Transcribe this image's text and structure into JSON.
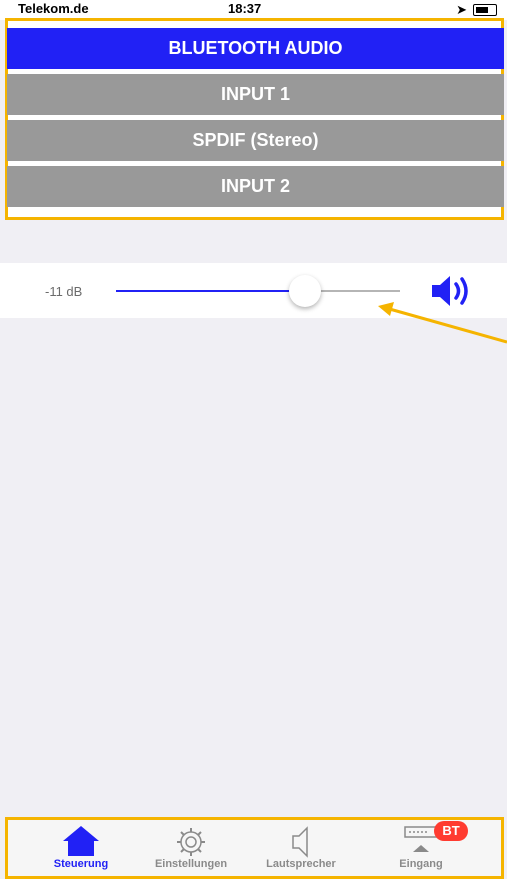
{
  "status_bar": {
    "carrier": "Telekom.de",
    "time": "18:37"
  },
  "inputs": [
    {
      "label": "BLUETOOTH AUDIO",
      "active": true
    },
    {
      "label": "INPUT 1",
      "active": false
    },
    {
      "label": "SPDIF (Stereo)",
      "active": false
    },
    {
      "label": "INPUT 2",
      "active": false
    }
  ],
  "volume": {
    "label": "-11 dB",
    "level_fraction": 0.67
  },
  "tabs": [
    {
      "label": "Steuerung",
      "icon": "house-icon",
      "active": true
    },
    {
      "label": "Einstellungen",
      "icon": "gear-icon",
      "active": false
    },
    {
      "label": "Lautsprecher",
      "icon": "speaker-outline-icon",
      "active": false
    },
    {
      "label": "Eingang",
      "icon": "input-device-icon",
      "active": false
    }
  ],
  "badge": {
    "label": "BT"
  },
  "colors": {
    "accent": "#2121f5",
    "inactive_button": "#999999",
    "annotation": "#f5b400",
    "badge": "#ff3b30"
  }
}
